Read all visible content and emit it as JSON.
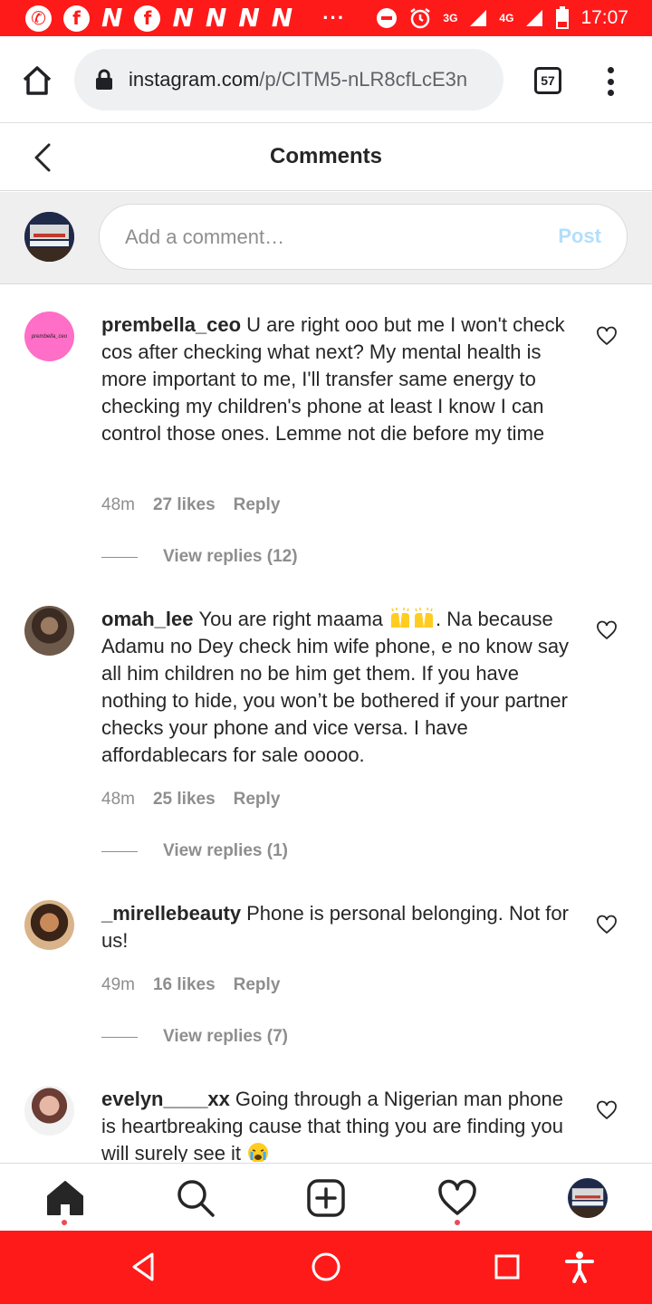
{
  "status_bar": {
    "left_icons": [
      "whatsapp-icon",
      "facebook-icon",
      "n-icon",
      "facebook-icon",
      "n-icon",
      "n-icon",
      "n-icon",
      "n-icon"
    ],
    "more": "···",
    "network_3g": "3G",
    "network_4g": "4G",
    "time": "17:07"
  },
  "browser": {
    "url_host": "instagram.com",
    "url_path": "/p/CITM5-nLR8cfLcE3n",
    "tab_count": "57"
  },
  "header": {
    "title": "Comments"
  },
  "add_comment": {
    "placeholder": "Add a comment…",
    "post_label": "Post"
  },
  "comments": [
    {
      "username": "prembella_ceo",
      "avatar_text": "prembella_ceo",
      "text": "U are right ooo but me I won't check cos after checking what next? My mental health is more important to me, I'll transfer same energy to checking my children's phone at least I know I can control those ones. Lemme not die before my time",
      "time": "48m",
      "likes": "27 likes",
      "reply_label": "Reply",
      "view_replies": "View replies (12)"
    },
    {
      "username": "omah_lee",
      "text_before_emoji": "You are right maama",
      "text_after_emoji": ". Na because Adamu no Dey check him wife phone, e no know say all him children no be him get them. If you have nothing to hide, you won’t be bothered if your partner checks your phone and vice versa. I have affordablecars for sale ooooo.",
      "time": "48m",
      "likes": "25 likes",
      "reply_label": "Reply",
      "view_replies": "View replies (1)"
    },
    {
      "username": "_mirellebeauty",
      "text": "Phone is personal belonging. Not for us!",
      "time": "49m",
      "likes": "16 likes",
      "reply_label": "Reply",
      "view_replies": "View replies (7)"
    },
    {
      "username": "evelyn____xx",
      "text": "Going through a Nigerian man phone is heartbreaking cause that thing you are finding you will surely see it"
    }
  ],
  "colors": {
    "status_bar": "#ff1a1a",
    "post_disabled": "#b2dffc",
    "meta_gray": "#8e8e8e",
    "notification_dot": "#ed4956"
  }
}
